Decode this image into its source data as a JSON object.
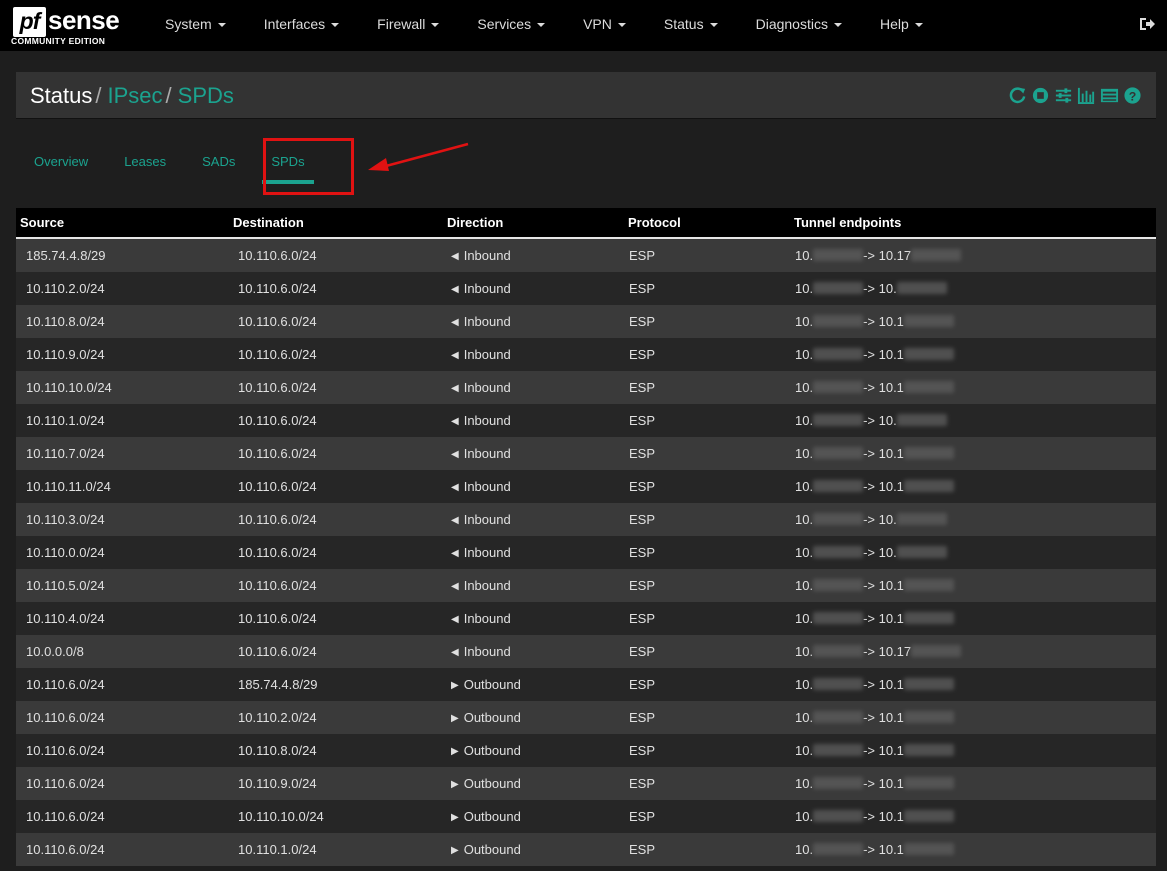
{
  "nav": {
    "logo_mark": "pf",
    "logo_word": "sense",
    "logo_sub": "COMMUNITY EDITION",
    "items": [
      {
        "label": "System"
      },
      {
        "label": "Interfaces"
      },
      {
        "label": "Firewall"
      },
      {
        "label": "Services"
      },
      {
        "label": "VPN"
      },
      {
        "label": "Status"
      },
      {
        "label": "Diagnostics"
      },
      {
        "label": "Help"
      }
    ],
    "logout_icon": "sign-out-icon"
  },
  "breadcrumb": {
    "root": "Status",
    "sep1": "/",
    "section": "IPsec",
    "sep2": "/",
    "page": "SPDs"
  },
  "header_icons": [
    "reload-icon",
    "stop-icon",
    "sliders-icon",
    "bar-chart-icon",
    "list-icon",
    "help-icon"
  ],
  "tabs": [
    {
      "label": "Overview",
      "active": false
    },
    {
      "label": "Leases",
      "active": false
    },
    {
      "label": "SADs",
      "active": false
    },
    {
      "label": "SPDs",
      "active": true
    }
  ],
  "accent_color": "#1ba38f",
  "table": {
    "headers": {
      "source": "Source",
      "destination": "Destination",
      "direction": "Direction",
      "protocol": "Protocol",
      "tunnel": "Tunnel endpoints"
    },
    "rows": [
      {
        "src": "185.74.4.8/29",
        "dst": "10.110.6.0/24",
        "dir": "Inbound",
        "proto": "ESP",
        "tun_a": "10.",
        "tun_b": "-> 10.17"
      },
      {
        "src": "10.110.2.0/24",
        "dst": "10.110.6.0/24",
        "dir": "Inbound",
        "proto": "ESP",
        "tun_a": "10.",
        "tun_b": "-> 10."
      },
      {
        "src": "10.110.8.0/24",
        "dst": "10.110.6.0/24",
        "dir": "Inbound",
        "proto": "ESP",
        "tun_a": "10.",
        "tun_b": "-> 10.1"
      },
      {
        "src": "10.110.9.0/24",
        "dst": "10.110.6.0/24",
        "dir": "Inbound",
        "proto": "ESP",
        "tun_a": "10.",
        "tun_b": "-> 10.1"
      },
      {
        "src": "10.110.10.0/24",
        "dst": "10.110.6.0/24",
        "dir": "Inbound",
        "proto": "ESP",
        "tun_a": "10.",
        "tun_b": "-> 10.1"
      },
      {
        "src": "10.110.1.0/24",
        "dst": "10.110.6.0/24",
        "dir": "Inbound",
        "proto": "ESP",
        "tun_a": "10.",
        "tun_b": "-> 10."
      },
      {
        "src": "10.110.7.0/24",
        "dst": "10.110.6.0/24",
        "dir": "Inbound",
        "proto": "ESP",
        "tun_a": "10.",
        "tun_b": "-> 10.1"
      },
      {
        "src": "10.110.11.0/24",
        "dst": "10.110.6.0/24",
        "dir": "Inbound",
        "proto": "ESP",
        "tun_a": "10.",
        "tun_b": "-> 10.1"
      },
      {
        "src": "10.110.3.0/24",
        "dst": "10.110.6.0/24",
        "dir": "Inbound",
        "proto": "ESP",
        "tun_a": "10.",
        "tun_b": "-> 10."
      },
      {
        "src": "10.110.0.0/24",
        "dst": "10.110.6.0/24",
        "dir": "Inbound",
        "proto": "ESP",
        "tun_a": "10.",
        "tun_b": "-> 10."
      },
      {
        "src": "10.110.5.0/24",
        "dst": "10.110.6.0/24",
        "dir": "Inbound",
        "proto": "ESP",
        "tun_a": "10.",
        "tun_b": "-> 10.1"
      },
      {
        "src": "10.110.4.0/24",
        "dst": "10.110.6.0/24",
        "dir": "Inbound",
        "proto": "ESP",
        "tun_a": "10.",
        "tun_b": "-> 10.1"
      },
      {
        "src": "10.0.0.0/8",
        "dst": "10.110.6.0/24",
        "dir": "Inbound",
        "proto": "ESP",
        "tun_a": "10.",
        "tun_b": "-> 10.17"
      },
      {
        "src": "10.110.6.0/24",
        "dst": "185.74.4.8/29",
        "dir": "Outbound",
        "proto": "ESP",
        "tun_a": "10.",
        "tun_b": "-> 10.1"
      },
      {
        "src": "10.110.6.0/24",
        "dst": "10.110.2.0/24",
        "dir": "Outbound",
        "proto": "ESP",
        "tun_a": "10.",
        "tun_b": "-> 10.1"
      },
      {
        "src": "10.110.6.0/24",
        "dst": "10.110.8.0/24",
        "dir": "Outbound",
        "proto": "ESP",
        "tun_a": "10.",
        "tun_b": "-> 10.1"
      },
      {
        "src": "10.110.6.0/24",
        "dst": "10.110.9.0/24",
        "dir": "Outbound",
        "proto": "ESP",
        "tun_a": "10.",
        "tun_b": "-> 10.1"
      },
      {
        "src": "10.110.6.0/24",
        "dst": "10.110.10.0/24",
        "dir": "Outbound",
        "proto": "ESP",
        "tun_a": "10.",
        "tun_b": "-> 10.1"
      },
      {
        "src": "10.110.6.0/24",
        "dst": "10.110.1.0/24",
        "dir": "Outbound",
        "proto": "ESP",
        "tun_a": "10.",
        "tun_b": "-> 10.1"
      }
    ]
  }
}
